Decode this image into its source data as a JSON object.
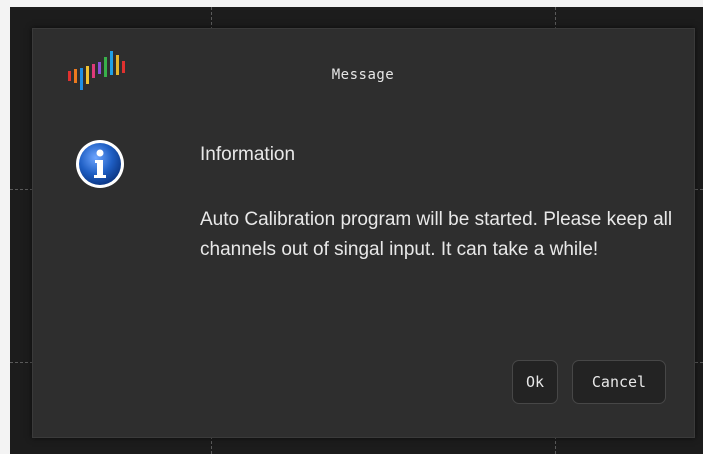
{
  "dialog": {
    "title": "Message",
    "logo_icon": "colored-bars-logo-icon",
    "info_icon": "information-icon",
    "heading": "Information",
    "message": "Auto Calibration program will be started. Please keep all channels out of singal input. It can take a while!",
    "ok_label": "Ok",
    "cancel_label": "Cancel"
  },
  "colors": {
    "background": "#1c1c1c",
    "dialog_background": "#2e2e2e",
    "button_background": "#232323",
    "button_border": "#474747",
    "text": "#e8e8e8",
    "info_icon_blue": "#1f5fc4"
  }
}
